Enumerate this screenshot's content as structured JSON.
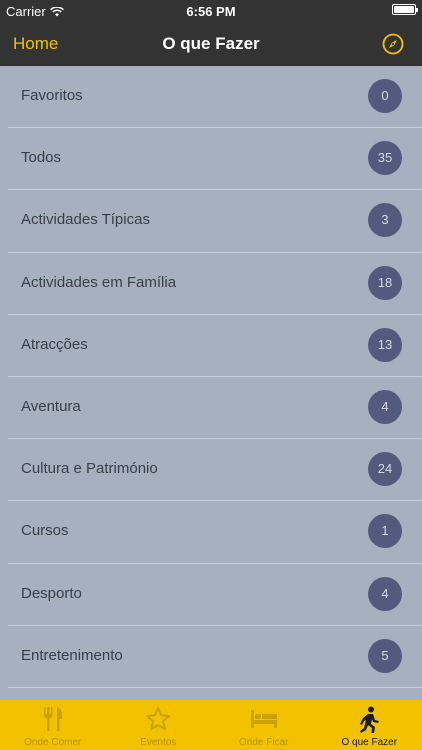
{
  "status_bar": {
    "carrier": "Carrier",
    "time": "6:56 PM",
    "battery_level": 1.0
  },
  "nav": {
    "back_label": "Home",
    "title": "O que Fazer",
    "right_icon": "compass-icon"
  },
  "categories": [
    {
      "label": "Favoritos",
      "count": "0"
    },
    {
      "label": "Todos",
      "count": "35"
    },
    {
      "label": "Actividades Típicas",
      "count": "3"
    },
    {
      "label": "Actividades em Família",
      "count": "18"
    },
    {
      "label": "Atracções",
      "count": "13"
    },
    {
      "label": "Aventura",
      "count": "4"
    },
    {
      "label": "Cultura e Património",
      "count": "24"
    },
    {
      "label": "Cursos",
      "count": "1"
    },
    {
      "label": "Desporto",
      "count": "4"
    },
    {
      "label": "Entretenimento",
      "count": "5"
    }
  ],
  "tab_bar": {
    "tabs": [
      {
        "label": "Onde Comer",
        "icon": "fork-knife-icon",
        "active": false
      },
      {
        "label": "Eventos",
        "icon": "star-icon",
        "active": false
      },
      {
        "label": "Onde Ficar",
        "icon": "bed-icon",
        "active": false
      },
      {
        "label": "O que Fazer",
        "icon": "hiker-icon",
        "active": true
      }
    ]
  },
  "colors": {
    "accent": "#f2c200",
    "bar": "#333333",
    "list_bg": "#a6b0bf",
    "badge": "#525b7e"
  }
}
